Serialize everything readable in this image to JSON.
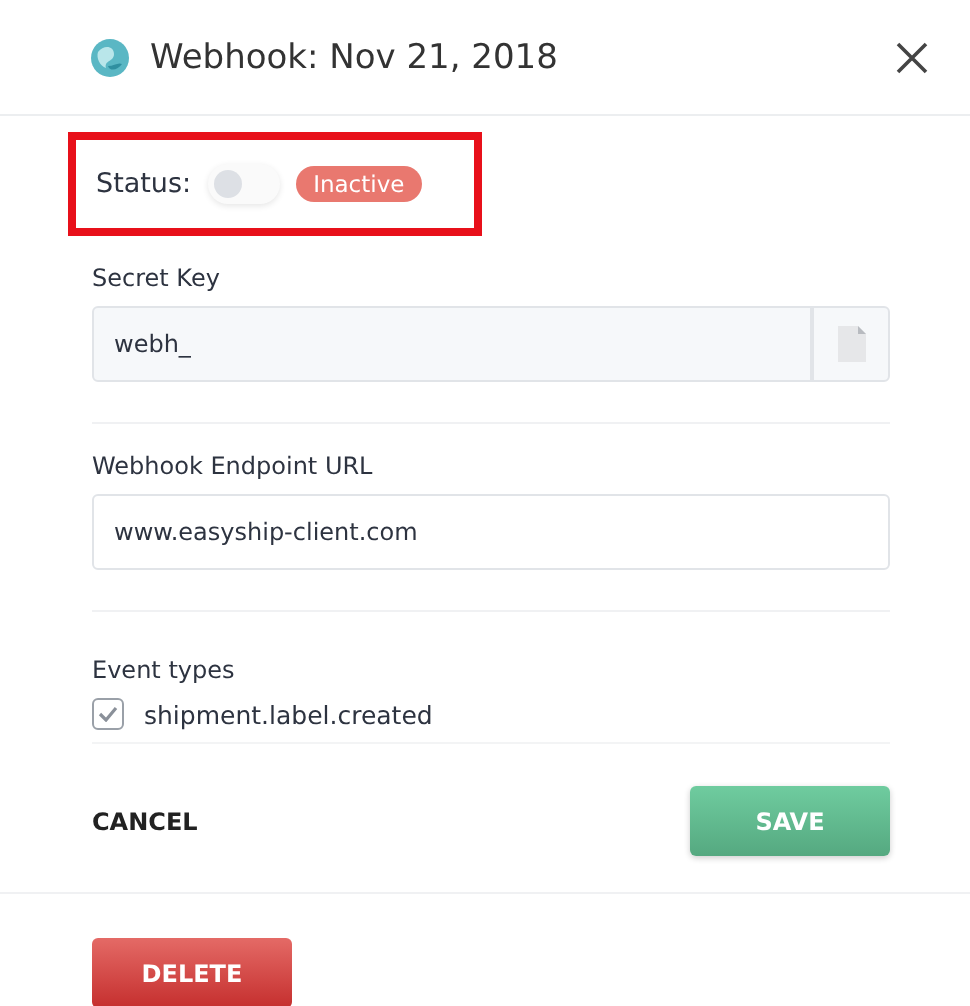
{
  "dialog": {
    "title": "Webhook: Nov 21, 2018"
  },
  "status": {
    "label": "Status:",
    "on": false,
    "badge": "Inactive",
    "highlighted": true
  },
  "secret_key": {
    "label": "Secret Key",
    "value": "webh_"
  },
  "endpoint": {
    "label": "Webhook Endpoint URL",
    "value": "www.easyship-client.com"
  },
  "event_types": {
    "label": "Event types",
    "items": [
      {
        "label": "shipment.label.created",
        "checked": true
      }
    ]
  },
  "buttons": {
    "cancel": "CANCEL",
    "save": "SAVE",
    "delete": "DELETE"
  }
}
